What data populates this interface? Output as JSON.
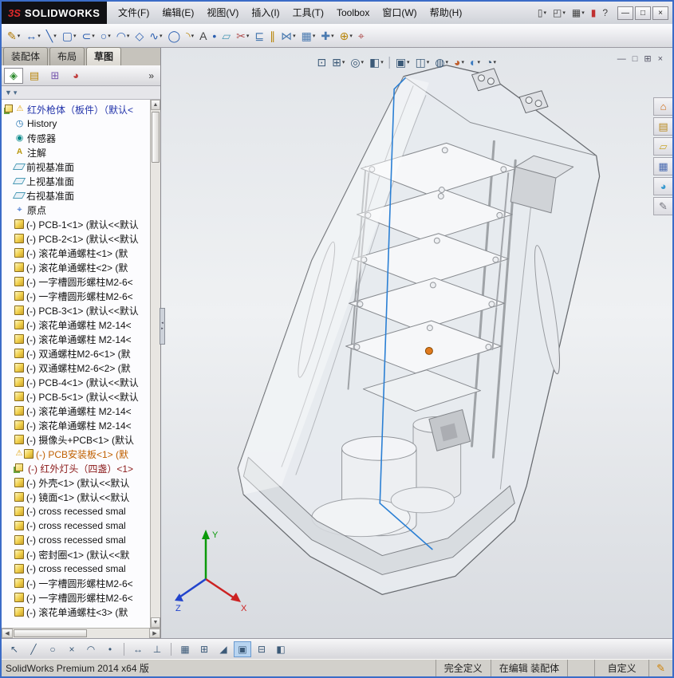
{
  "window": {
    "logo_mark": "3S",
    "logo_text": "SOLIDWORKS",
    "menus": [
      {
        "id": "file",
        "label": "文件(F)"
      },
      {
        "id": "edit",
        "label": "编辑(E)"
      },
      {
        "id": "view",
        "label": "视图(V)"
      },
      {
        "id": "insert",
        "label": "插入(I)"
      },
      {
        "id": "tools",
        "label": "工具(T)"
      },
      {
        "id": "toolbox",
        "label": "Toolbox"
      },
      {
        "id": "window",
        "label": "窗口(W)"
      },
      {
        "id": "help",
        "label": "帮助(H)"
      }
    ],
    "quick_tools": [
      {
        "name": "new-document",
        "glyph": "▯",
        "caret": true
      },
      {
        "name": "open-document",
        "glyph": "◰",
        "caret": true
      },
      {
        "name": "save-document",
        "glyph": "▦",
        "caret": true
      },
      {
        "name": "toolbox-toggle",
        "glyph": "▮",
        "color": "#c03030"
      },
      {
        "name": "help-menu",
        "glyph": "?"
      }
    ],
    "window_buttons": [
      {
        "name": "minimize",
        "glyph": "—"
      },
      {
        "name": "maximize",
        "glyph": "□"
      },
      {
        "name": "close",
        "glyph": "×"
      }
    ]
  },
  "sketch_toolbar": {
    "tools": [
      {
        "name": "sketch",
        "glyph": "✎",
        "color": "#b07800",
        "caret": true
      },
      {
        "name": "smart-dimension",
        "glyph": "↔",
        "color": "#2b5fb0",
        "caret": true
      },
      {
        "name": "line",
        "glyph": "╲",
        "color": "#2b5fb0",
        "caret": true
      },
      {
        "name": "corner-rectangle",
        "glyph": "▢",
        "color": "#2b5fb0",
        "caret": true
      },
      {
        "name": "straight-slot",
        "glyph": "⊂",
        "color": "#2b5fb0",
        "caret": true
      },
      {
        "name": "circle",
        "glyph": "○",
        "color": "#2b5fb0",
        "caret": true
      },
      {
        "name": "centerpoint-arc",
        "glyph": "◠",
        "color": "#2b5fb0",
        "caret": true
      },
      {
        "name": "polygon",
        "glyph": "◇",
        "color": "#2b5fb0"
      },
      {
        "name": "spline",
        "glyph": "∿",
        "color": "#2b5fb0",
        "caret": true
      },
      {
        "name": "ellipse",
        "glyph": "◯",
        "color": "#2b5fb0"
      },
      {
        "name": "sketch-fillet",
        "glyph": "◝",
        "color": "#b8860b",
        "caret": true
      },
      {
        "name": "text",
        "glyph": "A",
        "color": "#444444"
      },
      {
        "name": "point",
        "glyph": "•",
        "color": "#2b5fb0"
      },
      {
        "name": "plane",
        "glyph": "▱",
        "color": "#4a9ab5"
      },
      {
        "name": "trim-entities",
        "glyph": "✂",
        "color": "#b05050",
        "caret": true
      },
      {
        "name": "convert-entities",
        "glyph": "⊑",
        "color": "#4a7ab0"
      },
      {
        "name": "offset-entities",
        "glyph": "∥",
        "color": "#b8860b"
      },
      {
        "name": "mirror-entities",
        "glyph": "⋈",
        "color": "#4a7ab0",
        "caret": true
      },
      {
        "name": "linear-sketch-pattern",
        "glyph": "▦",
        "color": "#4a7ab0",
        "caret": true
      },
      {
        "name": "move-entities",
        "glyph": "✚",
        "color": "#4a7ab0",
        "caret": true
      },
      {
        "name": "display-delete-relations",
        "glyph": "⊕",
        "color": "#b8860b",
        "caret": true
      },
      {
        "name": "repair-sketch",
        "glyph": "⌖",
        "color": "#b05050"
      }
    ]
  },
  "tabs": [
    {
      "name": "assembly",
      "label": "装配体"
    },
    {
      "name": "layout",
      "label": "布局"
    },
    {
      "name": "sketch",
      "label": "草图",
      "active": true
    }
  ],
  "panel": {
    "header_tabs": [
      {
        "name": "featuremanager",
        "glyph": "◈",
        "color": "#2e8b2e",
        "active": true
      },
      {
        "name": "propertymanager",
        "glyph": "▤",
        "color": "#b8860b"
      },
      {
        "name": "configurationmanager",
        "glyph": "⊞",
        "color": "#7a5ab0"
      },
      {
        "name": "displaymanager",
        "glyph": "◕",
        "color": "#c04040"
      }
    ],
    "expand_label": "»",
    "filter_icon": "▼",
    "filter_caret": "▾",
    "tree": {
      "root": {
        "label": "红外枪体（板件）（默认<",
        "color": "#2233aa"
      },
      "items": [
        {
          "icon": "history",
          "label": "History"
        },
        {
          "icon": "sensor",
          "label": "传感器"
        },
        {
          "icon": "annotation",
          "label": "注解"
        },
        {
          "icon": "plane",
          "label": "前视基准面"
        },
        {
          "icon": "plane",
          "label": "上视基准面"
        },
        {
          "icon": "plane",
          "label": "右视基准面"
        },
        {
          "icon": "origin",
          "label": "原点"
        },
        {
          "icon": "part",
          "label": "(-) PCB-1<1> (默认<<默认"
        },
        {
          "icon": "part",
          "label": "(-) PCB-2<1> (默认<<默认"
        },
        {
          "icon": "part",
          "label": "(-) 滚花单通螺柱<1> (默"
        },
        {
          "icon": "part",
          "label": "(-) 滚花单通螺柱<2> (默"
        },
        {
          "icon": "part",
          "label": "(-) 一字槽圆形螺柱M2-6<"
        },
        {
          "icon": "part",
          "label": "(-) 一字槽圆形螺柱M2-6<"
        },
        {
          "icon": "part",
          "label": "(-) PCB-3<1> (默认<<默认"
        },
        {
          "icon": "part",
          "label": "(-) 滚花单通螺柱 M2-14<"
        },
        {
          "icon": "part",
          "label": "(-) 滚花单通螺柱 M2-14<"
        },
        {
          "icon": "part",
          "label": "(-) 双通螺柱M2-6<1> (默"
        },
        {
          "icon": "part",
          "label": "(-) 双通螺柱M2-6<2> (默"
        },
        {
          "icon": "part",
          "label": "(-) PCB-4<1> (默认<<默认"
        },
        {
          "icon": "part",
          "label": "(-) PCB-5<1> (默认<<默认"
        },
        {
          "icon": "part",
          "label": "(-) 滚花单通螺柱 M2-14<"
        },
        {
          "icon": "part",
          "label": "(-) 滚花单通螺柱 M2-14<"
        },
        {
          "icon": "part",
          "label": "(-) 摄像头+PCB<1> (默认"
        },
        {
          "icon": "part-warn",
          "label": "(-) PCB安装板<1> (默",
          "color": "#c06000"
        },
        {
          "icon": "asm",
          "label": "(-) 红外灯头（四盏）<1>",
          "color": "#8b1a1a"
        },
        {
          "icon": "part",
          "label": "(-) 外壳<1> (默认<<默认"
        },
        {
          "icon": "part",
          "label": "(-) 镜面<1> (默认<<默认"
        },
        {
          "icon": "part",
          "label": "(-) cross recessed smal"
        },
        {
          "icon": "part",
          "label": "(-) cross recessed smal"
        },
        {
          "icon": "part",
          "label": "(-) cross recessed smal"
        },
        {
          "icon": "part",
          "label": "(-) 密封圈<1> (默认<<默"
        },
        {
          "icon": "part",
          "label": "(-) cross recessed smal"
        },
        {
          "icon": "part",
          "label": "(-) 一字槽圆形螺柱M2-6<"
        },
        {
          "icon": "part",
          "label": "(-) 一字槽圆形螺柱M2-6<"
        },
        {
          "icon": "part",
          "label": "(-) 滚花单通螺柱<3> (默"
        }
      ]
    }
  },
  "viewport": {
    "hud": [
      {
        "name": "zoom-fit",
        "glyph": "⊡"
      },
      {
        "name": "zoom-area",
        "glyph": "⊞",
        "caret": true
      },
      {
        "name": "previous-view",
        "glyph": "◎",
        "caret": true
      },
      {
        "name": "section-view",
        "glyph": "◧",
        "caret": true
      },
      {
        "sep": true
      },
      {
        "name": "view-orientation",
        "glyph": "▣",
        "caret": true
      },
      {
        "name": "display-style",
        "glyph": "◫",
        "caret": true
      },
      {
        "name": "hide-show-items",
        "glyph": "◍",
        "caret": true
      },
      {
        "name": "edit-appearance",
        "glyph": "◕",
        "color": "#c06030",
        "caret": true
      },
      {
        "name": "apply-scene",
        "glyph": "◐",
        "color": "#3a7ac0",
        "caret": true
      },
      {
        "name": "view-settings",
        "glyph": "◔",
        "caret": true
      }
    ],
    "doc_buttons": [
      {
        "name": "doc-minimize",
        "glyph": "—"
      },
      {
        "name": "doc-restore",
        "glyph": "□"
      },
      {
        "name": "doc-new-window",
        "glyph": "⊞"
      },
      {
        "name": "doc-close",
        "glyph": "×"
      }
    ],
    "taskpane": [
      {
        "name": "solidworks-resources",
        "glyph": "⌂",
        "color": "#d06a10"
      },
      {
        "name": "design-library",
        "glyph": "▤",
        "color": "#b8891f"
      },
      {
        "name": "file-explorer",
        "glyph": "▱",
        "color": "#c8a52a"
      },
      {
        "name": "view-palette",
        "glyph": "▦",
        "color": "#4a6ab0"
      },
      {
        "name": "appearances-scenes",
        "glyph": "◕",
        "color": "#3a9ad0"
      },
      {
        "name": "custom-properties",
        "glyph": "✎",
        "color": "#70707a"
      }
    ],
    "triad": {
      "x": "X",
      "y": "Y",
      "z": "Z"
    }
  },
  "bottom_toolbar": {
    "tools": [
      {
        "name": "select",
        "glyph": "↖"
      },
      {
        "name": "sketch-line",
        "glyph": "╱"
      },
      {
        "name": "sketch-circle",
        "glyph": "○"
      },
      {
        "name": "sketch-delete",
        "glyph": "×"
      },
      {
        "name": "sketch-arc",
        "glyph": "◠"
      },
      {
        "name": "sketch-point",
        "glyph": "•"
      },
      {
        "sep": true
      },
      {
        "name": "dimension",
        "glyph": "↔"
      },
      {
        "name": "add-relations",
        "glyph": "⊥"
      },
      {
        "sep": true
      },
      {
        "name": "grid",
        "glyph": "▦"
      },
      {
        "name": "wireframe",
        "glyph": "⊞"
      },
      {
        "name": "hidden-lines",
        "glyph": "◢"
      },
      {
        "name": "shaded-with-edges",
        "glyph": "▣",
        "active": true
      },
      {
        "name": "shaded",
        "glyph": "⊟"
      },
      {
        "name": "section",
        "glyph": "◧"
      }
    ]
  },
  "scrollbar": {
    "up": "▲",
    "down": "▼",
    "left": "◀",
    "right": "▶",
    "split_left": "◂",
    "split_right": "▸"
  },
  "statusbar": {
    "product": "SolidWorks Premium 2014 x64 版",
    "defined": "完全定义",
    "editing": "在编辑 装配体",
    "custom": "自定义",
    "help_icon": "✎"
  },
  "colors": {
    "selection": "#2a7fd4",
    "marker": "#e07a1e"
  }
}
